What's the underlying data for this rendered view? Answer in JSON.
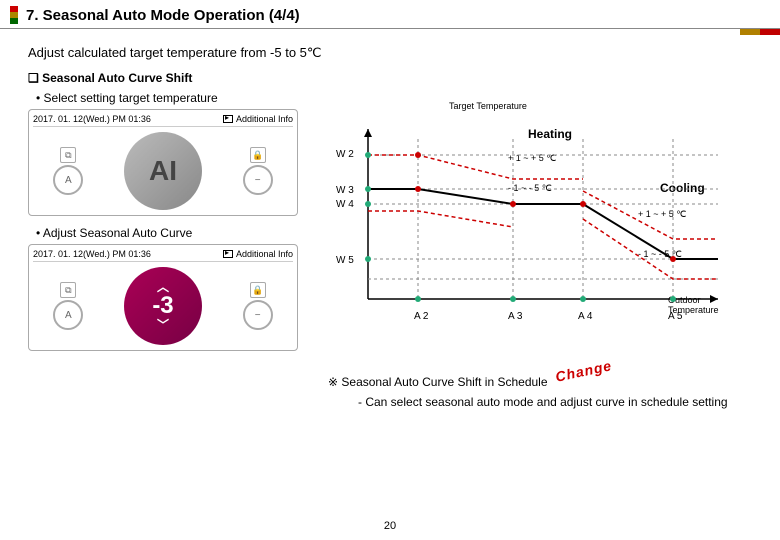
{
  "title": "7. Seasonal Auto Mode Operation (4/4)",
  "desc": "Adjust calculated target temperature from -5 to 5℃",
  "section": "❑ Seasonal Auto Curve Shift",
  "bullet1": "• Select setting target temperature",
  "bullet2": "• Adjust Seasonal Auto Curve",
  "panel": {
    "timestamp": "2017. 01. 12(Wed.) PM 01:36",
    "additional": "Additional Info",
    "left_mode": "A",
    "val_ai": "AI",
    "val_neg3": "-3",
    "lock": "🔒",
    "dash": "−"
  },
  "chart": {
    "y_title": "Target Temperature",
    "heating": "Heating",
    "cooling": "Cooling",
    "x_title": "Outdoor Temperature",
    "y_labels": [
      "W 2",
      "W 3",
      "W 4",
      "W 5"
    ],
    "x_labels": [
      "A 2",
      "A 3",
      "A 4",
      "A 5"
    ],
    "r1": "+ 1 ~ + 5 ℃",
    "r2": "- 1 ~ - 5 ℃",
    "r3": "+ 1 ~ + 5 ℃",
    "r4": "- 1 ~ - 5 ℃"
  },
  "note": "※ Seasonal Auto Curve Shift in Schedule",
  "change": "Change",
  "sub_note": "- Can select seasonal auto mode and adjust curve in schedule setting",
  "page": "20",
  "chart_data": {
    "type": "line",
    "description": "Piecewise curve of target temperature vs outdoor temperature. Heating segment slopes down between x=A2 and x=A3 (from y=W3 to y=W4). Cooling segment slopes down between x=A4 and x=A5 (from y=W4 to y=W5). Dashed red curves show ±1~±5℃ shifts around each segment.",
    "x_breakpoints": [
      "A2",
      "A3",
      "A4",
      "A5"
    ],
    "y_breakpoints": [
      "W2",
      "W3",
      "W4",
      "W5"
    ],
    "heating_segment": {
      "x": [
        "A2",
        "A3"
      ],
      "y": [
        "W3",
        "W4"
      ],
      "shift_up": "+1~+5℃ (to W2)",
      "shift_down": "-1~-5℃"
    },
    "cooling_segment": {
      "x": [
        "A4",
        "A5"
      ],
      "y": [
        "W4",
        "W5"
      ],
      "shift_up": "+1~+5℃",
      "shift_down": "-1~-5℃"
    }
  }
}
